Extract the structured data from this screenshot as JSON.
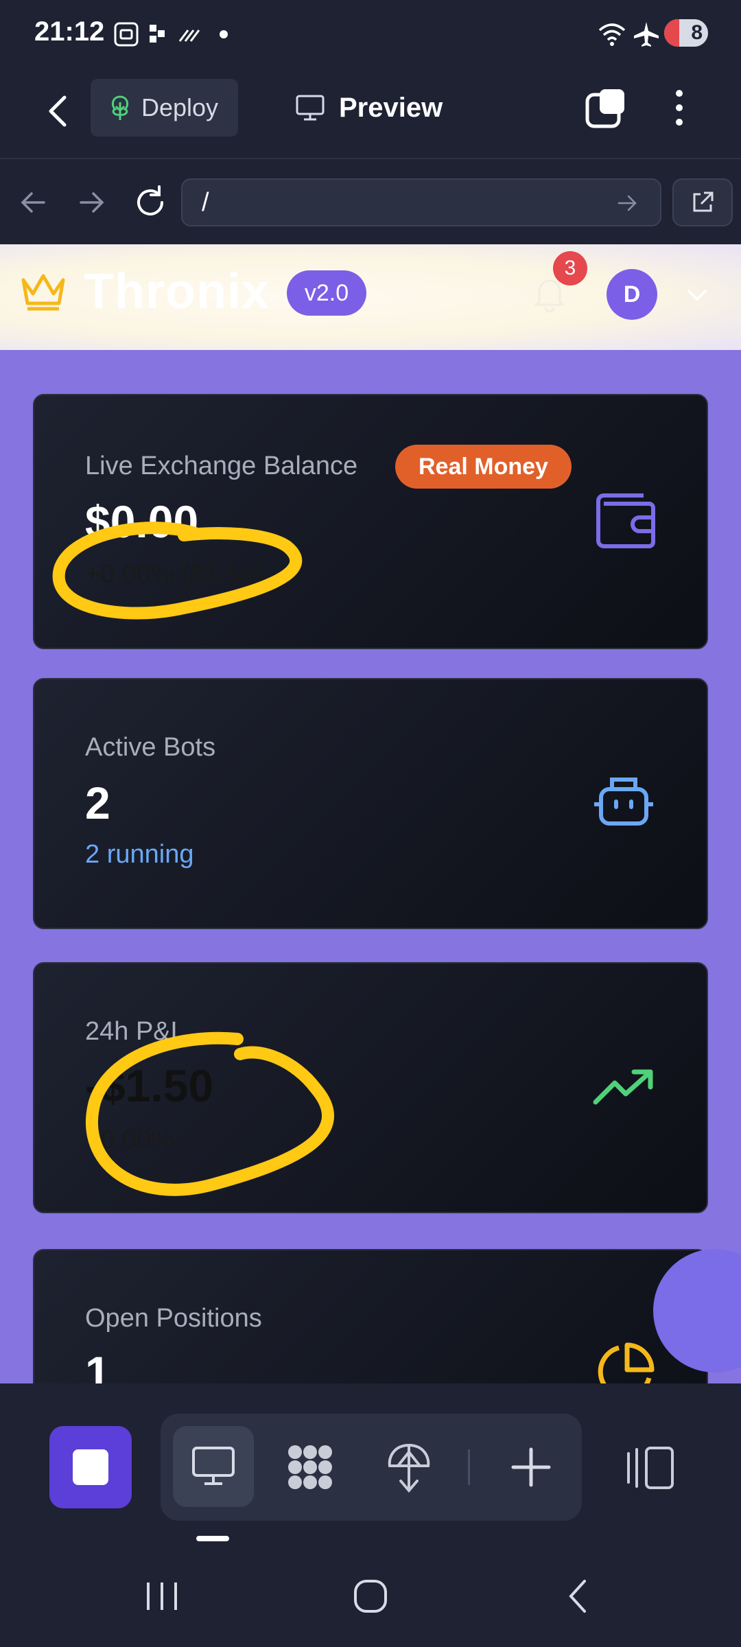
{
  "status_bar": {
    "time": "21:12",
    "battery": "8",
    "icons": [
      "screenshot-icon",
      "app-icon",
      "sound-icon",
      "dot-icon",
      "wifi-icon",
      "airplane-icon",
      "battery-icon"
    ]
  },
  "app_header": {
    "deploy_label": "Deploy",
    "preview_label": "Preview"
  },
  "url_bar": {
    "value": "/"
  },
  "site": {
    "brand": "Thronix",
    "version": "v2.0",
    "notification_count": "3",
    "avatar_initial": "D"
  },
  "cards": {
    "balance": {
      "label": "Live Exchange Balance",
      "badge": "Real Money",
      "value": "$0.00",
      "change": "+0.00% ($1.50)"
    },
    "bots": {
      "label": "Active Bots",
      "value": "2",
      "sub": "2 running"
    },
    "pnl": {
      "label": "24h P&L",
      "value": "-$1.50",
      "change": "+0.00%"
    },
    "positions": {
      "label": "Open Positions",
      "value": "1"
    }
  },
  "colors": {
    "accent": "#7b5fe6",
    "page_bg": "#8674e0",
    "card_bg": "#0d0f16",
    "badge_orange": "#e1602a",
    "link_blue": "#6aa8f5",
    "trend_green": "#4fd17a",
    "annotation_yellow": "#ffc914"
  }
}
